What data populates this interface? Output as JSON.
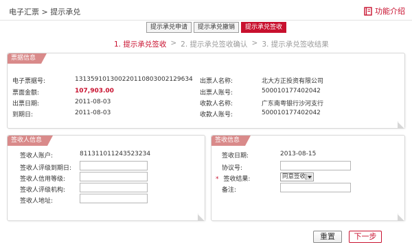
{
  "header": {
    "breadcrumb_parent": "电子汇票",
    "breadcrumb_sep": " > ",
    "breadcrumb_current": "提示承兑",
    "help_label": "功能介绍",
    "help_icon": "book-icon"
  },
  "tabs": [
    {
      "label": "提示承兑申请"
    },
    {
      "label": "提示承兑撤销"
    },
    {
      "label": "提示承兑签收",
      "active": true
    }
  ],
  "steps": [
    {
      "label": "1. 提示承兑签收"
    },
    {
      "label": ">"
    },
    {
      "label": "2. 提示承兑签收确认"
    },
    {
      "label": ">"
    },
    {
      "label": "3. 提示承兑签收结果"
    }
  ],
  "bill_info": {
    "title": "票据信息",
    "left": [
      {
        "label": "电子票据号:",
        "value": "131359101300220110803002129634"
      },
      {
        "label": "票面金额:",
        "value": "107,903.00"
      },
      {
        "label": "出票日期:",
        "value": "2011-08-03"
      },
      {
        "label": "到期日:",
        "value": "2011-08-03"
      }
    ],
    "right": [
      {
        "label": "出票人名称:",
        "value": "北大方正投资有限公司"
      },
      {
        "label": "出票人账号:",
        "value": "500010177402042"
      },
      {
        "label": "收款人名称:",
        "value": "广东南粤银行沙河支行"
      },
      {
        "label": "收款人账号:",
        "value": "500010177402042"
      }
    ]
  },
  "signer_info": {
    "title": "签收人信息",
    "account_label": "签收人账户:",
    "account_value": "811311011243523234",
    "fields": [
      {
        "label": "签收人评级到期日:",
        "value": ""
      },
      {
        "label": "签收人信用等级:",
        "value": ""
      },
      {
        "label": "签收人评级机构:",
        "value": ""
      },
      {
        "label": "签收人地址:",
        "value": ""
      }
    ]
  },
  "sign_info": {
    "title": "签收信息",
    "date_label": "签收日期:",
    "date_value": "2013-08-15",
    "protocol_label": "协议号:",
    "protocol_value": "",
    "required_mark": "*",
    "result_label": "签收结果:",
    "result_value": "同意签收",
    "remark_label": "备注:",
    "remark_value": ""
  },
  "buttons": {
    "reset": "重置",
    "next": "下一步"
  },
  "colors": {
    "accent": "#c8102e",
    "panel_header": "#d98a8a"
  }
}
